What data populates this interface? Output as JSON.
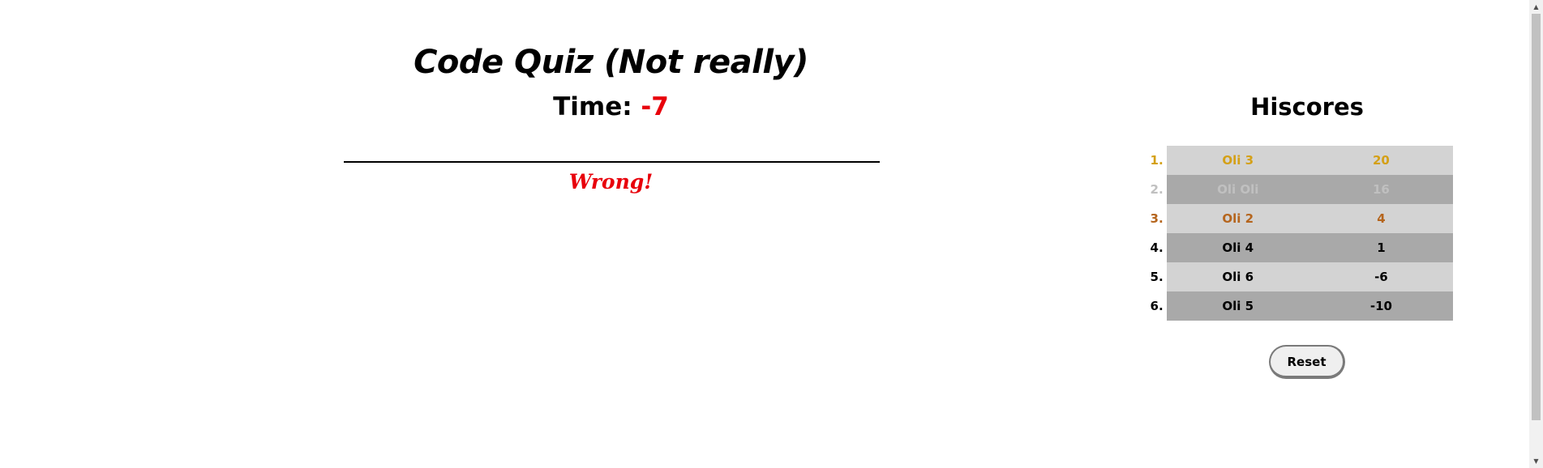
{
  "quiz": {
    "title": "Code Quiz (Not really)",
    "time_label": "Time:",
    "time_value": "-7",
    "feedback": "Wrong!"
  },
  "hiscores": {
    "title": "Hiscores",
    "rows": [
      {
        "rank": "1.",
        "name": "Oli 3",
        "score": "20",
        "color": "#d4a017"
      },
      {
        "rank": "2.",
        "name": "Oli Oli",
        "score": "16",
        "color": "#c0c0c0"
      },
      {
        "rank": "3.",
        "name": "Oli 2",
        "score": "4",
        "color": "#b5651d"
      },
      {
        "rank": "4.",
        "name": "Oli 4",
        "score": "1",
        "color": "#000000"
      },
      {
        "rank": "5.",
        "name": "Oli 6",
        "score": "-6",
        "color": "#000000"
      },
      {
        "rank": "6.",
        "name": "Oli 5",
        "score": "-10",
        "color": "#000000"
      }
    ],
    "reset_label": "Reset"
  },
  "colors": {
    "accent_red": "#e8000b",
    "row_light": "#d3d3d3",
    "row_dark": "#a9a9a9"
  },
  "icons": {
    "scroll_up": "scroll-up-arrow-icon",
    "scroll_down": "scroll-down-arrow-icon"
  }
}
